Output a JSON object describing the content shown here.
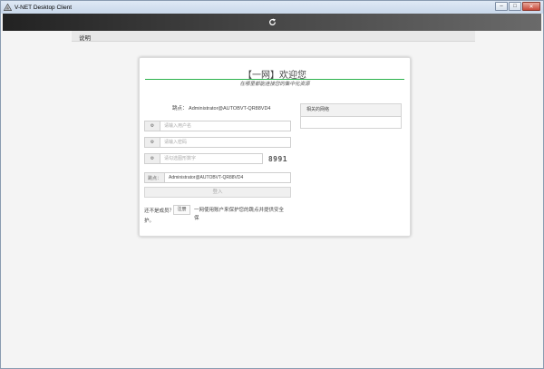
{
  "window": {
    "title": "V-NET Desktop Client",
    "minimize": "–",
    "maximize": "□",
    "close": "✕"
  },
  "toolbar": {
    "refresh_icon": "refresh-icon"
  },
  "nav": {
    "link": "说明"
  },
  "card": {
    "title": "【一网】欢迎您",
    "subtitle": "在哪里都能连接您的集中化资源",
    "node_text": "跳点：  Administrator@AUTOBVT-QR88VD4",
    "username_placeholder": "请输入用户名",
    "password_placeholder": "请输入密码",
    "captcha_placeholder": "请勾选图形数字",
    "captcha_value": "8991",
    "node_addon": "跳点：",
    "node_value": "Administrator@AUTOBVT-QR88VD4",
    "login_label": "登入",
    "not_member": "还不是成员？",
    "register_label": "注册",
    "policy_line1": "一网使用账户来保护您的跳点并提供安全保",
    "policy_line2": "护。"
  },
  "related": {
    "title": "相关的网络"
  },
  "colors": {
    "accent": "#2bb24c",
    "toolbar": "#2b2b2b"
  }
}
